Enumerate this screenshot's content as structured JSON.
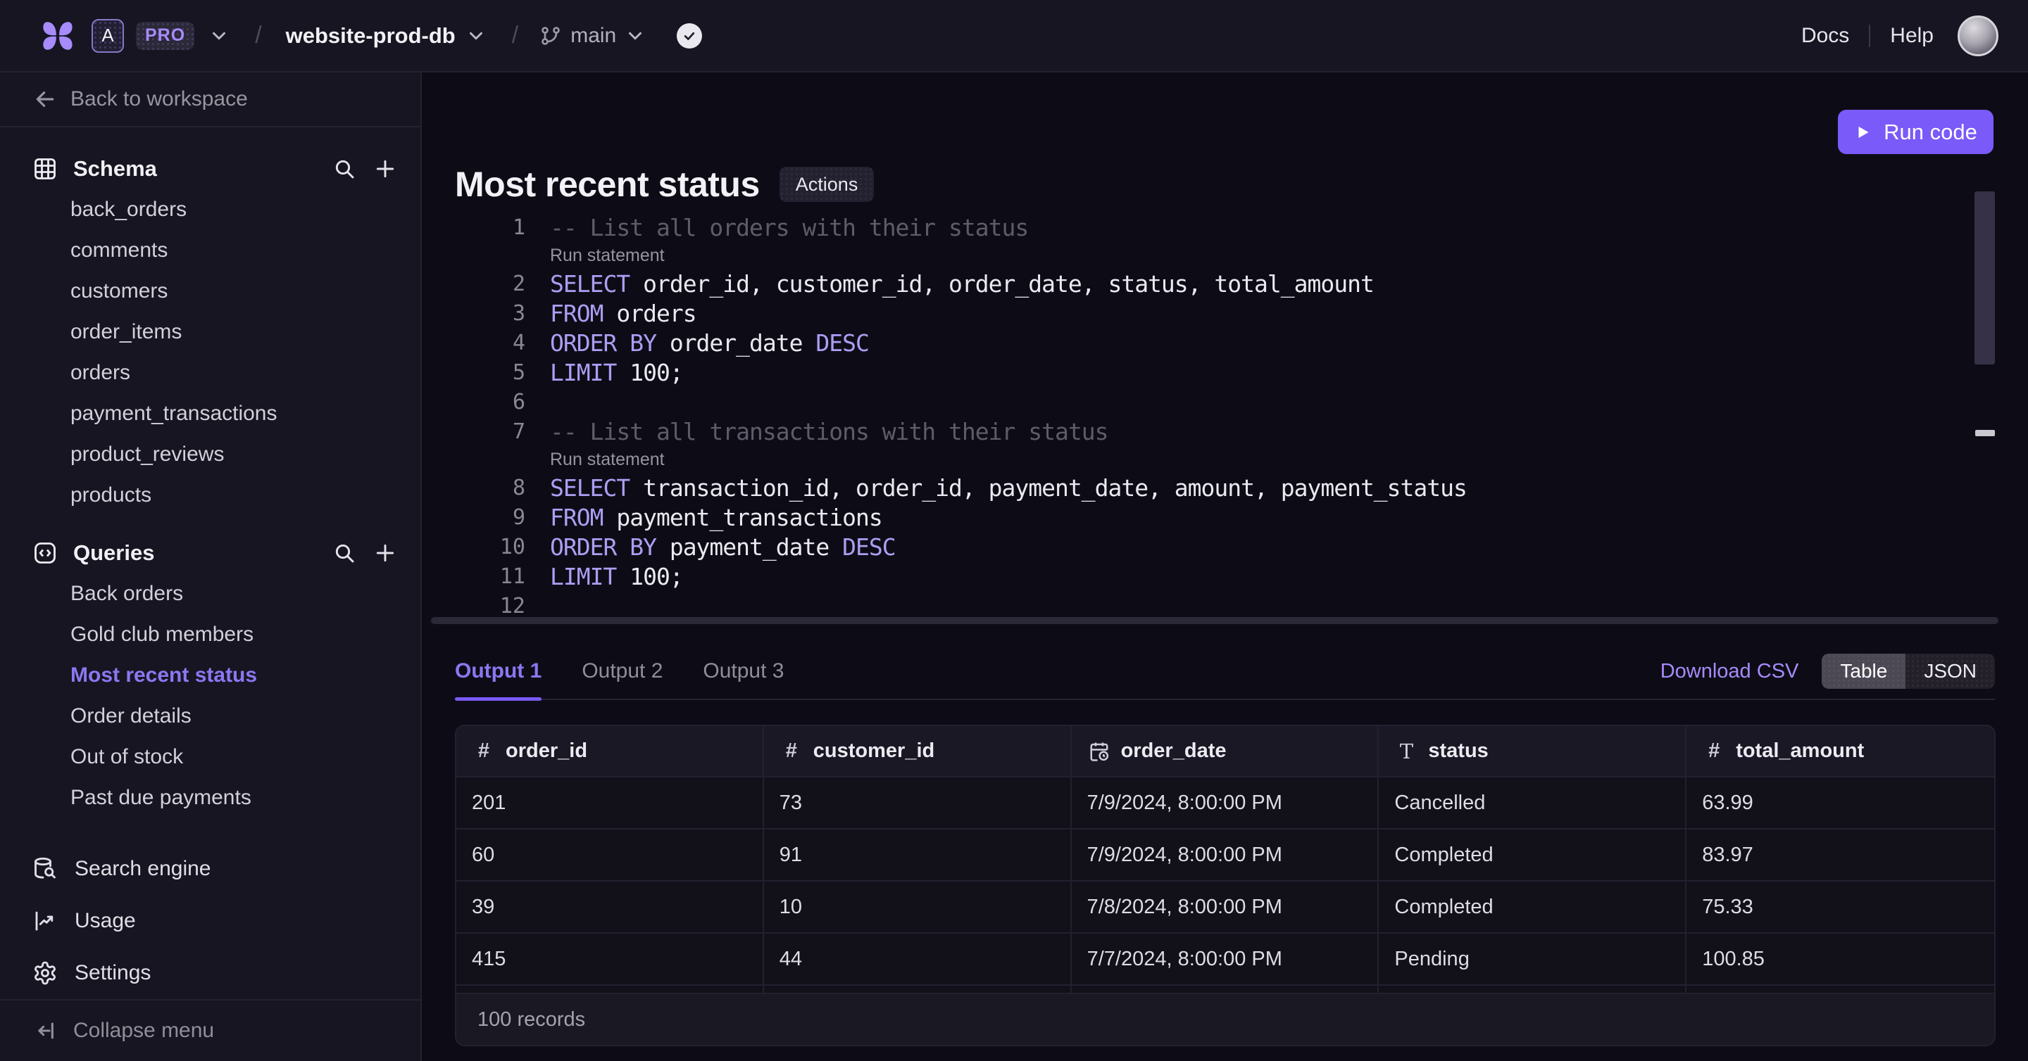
{
  "topbar": {
    "workspace_initial": "A",
    "plan_badge": "PRO",
    "separator": "/",
    "database_name": "website-prod-db",
    "branch_name": "main",
    "docs_label": "Docs",
    "help_label": "Help"
  },
  "sidebar": {
    "back_label": "Back to workspace",
    "schema": {
      "title": "Schema",
      "items": [
        "back_orders",
        "comments",
        "customers",
        "order_items",
        "orders",
        "payment_transactions",
        "product_reviews",
        "products"
      ]
    },
    "queries": {
      "title": "Queries",
      "items": [
        "Back orders",
        "Gold club members",
        "Most recent status",
        "Order details",
        "Out of stock",
        "Past due payments"
      ],
      "active_item": "Most recent status"
    },
    "footer_items": [
      "Search engine",
      "Usage",
      "Settings"
    ],
    "collapse_label": "Collapse menu"
  },
  "main": {
    "title": "Most recent status",
    "actions_label": "Actions",
    "run_code_label": "Run code"
  },
  "editor": {
    "rows": [
      {
        "type": "code",
        "n": "1",
        "seg": [
          [
            "cm",
            "-- List all orders with their status"
          ]
        ]
      },
      {
        "type": "widget",
        "label": "Run statement"
      },
      {
        "type": "code",
        "n": "2",
        "seg": [
          [
            "kw",
            "SELECT"
          ],
          [
            "pl",
            " order_id, customer_id, order_date, status, total_amount"
          ]
        ]
      },
      {
        "type": "code",
        "n": "3",
        "seg": [
          [
            "kw",
            "FROM"
          ],
          [
            "pl",
            " orders"
          ]
        ]
      },
      {
        "type": "code",
        "n": "4",
        "seg": [
          [
            "kw",
            "ORDER BY"
          ],
          [
            "pl",
            " order_date "
          ],
          [
            "kw",
            "DESC"
          ]
        ]
      },
      {
        "type": "code",
        "n": "5",
        "seg": [
          [
            "kw",
            "LIMIT"
          ],
          [
            "pl",
            " 100;"
          ]
        ]
      },
      {
        "type": "code",
        "n": "6",
        "seg": []
      },
      {
        "type": "code",
        "n": "7",
        "seg": [
          [
            "cm",
            "-- List all transactions with their status"
          ]
        ]
      },
      {
        "type": "widget",
        "label": "Run statement"
      },
      {
        "type": "code",
        "n": "8",
        "seg": [
          [
            "kw",
            "SELECT"
          ],
          [
            "pl",
            " transaction_id, order_id, payment_date, amount, payment_status"
          ]
        ]
      },
      {
        "type": "code",
        "n": "9",
        "seg": [
          [
            "kw",
            "FROM"
          ],
          [
            "pl",
            " payment_transactions"
          ]
        ]
      },
      {
        "type": "code",
        "n": "10",
        "seg": [
          [
            "kw",
            "ORDER BY"
          ],
          [
            "pl",
            " payment_date "
          ],
          [
            "kw",
            "DESC"
          ]
        ]
      },
      {
        "type": "code",
        "n": "11",
        "seg": [
          [
            "kw",
            "LIMIT"
          ],
          [
            "pl",
            " 100;"
          ]
        ]
      },
      {
        "type": "code",
        "n": "12",
        "seg": []
      }
    ]
  },
  "output": {
    "tabs": [
      "Output 1",
      "Output 2",
      "Output 3"
    ],
    "active_tab": "Output 1",
    "download_label": "Download CSV",
    "view_options": [
      "Table",
      "JSON"
    ],
    "active_view": "Table"
  },
  "results": {
    "columns": [
      {
        "type": "number",
        "label": "order_id"
      },
      {
        "type": "number",
        "label": "customer_id"
      },
      {
        "type": "date",
        "label": "order_date"
      },
      {
        "type": "text",
        "label": "status"
      },
      {
        "type": "number",
        "label": "total_amount"
      }
    ],
    "rows": [
      [
        "201",
        "73",
        "7/9/2024, 8:00:00 PM",
        "Cancelled",
        "63.99"
      ],
      [
        "60",
        "91",
        "7/9/2024, 8:00:00 PM",
        "Completed",
        "83.97"
      ],
      [
        "39",
        "10",
        "7/8/2024, 8:00:00 PM",
        "Completed",
        "75.33"
      ],
      [
        "415",
        "44",
        "7/7/2024, 8:00:00 PM",
        "Pending",
        "100.85"
      ]
    ],
    "footer": "100 records"
  },
  "colors": {
    "accent_purple": "#7A5AF8",
    "link_purple": "#A78BFA",
    "active_item_purple": "#8B77F2",
    "page_bg": "#0D0C16",
    "panel_bg": "#161521",
    "table_header_bg": "#1A1824",
    "border": "#232130"
  }
}
